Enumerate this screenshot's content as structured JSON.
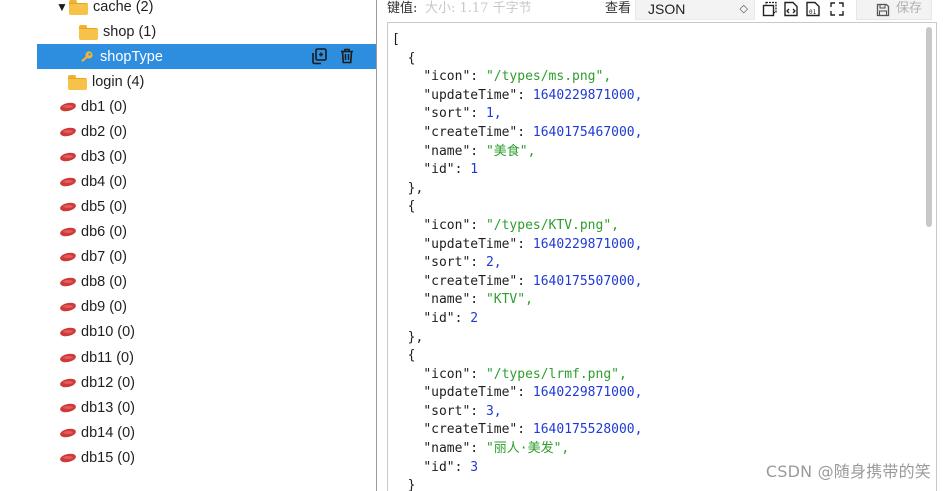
{
  "tree": {
    "cache": {
      "label": "cache (2)",
      "arrow": "▼"
    },
    "shop": {
      "label": "shop (1)"
    },
    "shopType": {
      "label": "shopType"
    },
    "login": {
      "label": "login (4)"
    },
    "dbs": [
      {
        "name": "db1",
        "count": "(0)"
      },
      {
        "name": "db2",
        "count": "(0)"
      },
      {
        "name": "db3",
        "count": "(0)"
      },
      {
        "name": "db4",
        "count": "(0)"
      },
      {
        "name": "db5",
        "count": "(0)"
      },
      {
        "name": "db6",
        "count": "(0)"
      },
      {
        "name": "db7",
        "count": "(0)"
      },
      {
        "name": "db8",
        "count": "(0)"
      },
      {
        "name": "db9",
        "count": "(0)"
      },
      {
        "name": "db10",
        "count": "(0)"
      },
      {
        "name": "db11",
        "count": "(0)"
      },
      {
        "name": "db12",
        "count": "(0)"
      },
      {
        "name": "db13",
        "count": "(0)"
      },
      {
        "name": "db14",
        "count": "(0)"
      },
      {
        "name": "db15",
        "count": "(0)"
      }
    ]
  },
  "toolbar": {
    "key_label": "键值:",
    "size_info": "大小: 1.17 千字节",
    "view_label": "查看",
    "format": "JSON",
    "save_label": "保存"
  },
  "items": [
    {
      "icon": "/types/ms.png",
      "updateTime": "1640229871000",
      "sort": "1",
      "createTime": "1640175467000",
      "name": "美食",
      "id": "1"
    },
    {
      "icon": "/types/KTV.png",
      "updateTime": "1640229871000",
      "sort": "2",
      "createTime": "1640175507000",
      "name": "KTV",
      "id": "2"
    },
    {
      "icon": "/types/lrmf.png",
      "updateTime": "1640229871000",
      "sort": "3",
      "createTime": "1640175528000",
      "name": "丽人·美发",
      "id": "3"
    }
  ],
  "watermark": "CSDN @随身携带的笑",
  "colors": {
    "selected_row": "#2d8ee0",
    "string": "#2e9e2e",
    "number": "#1f3ad6",
    "db_icon": "#cc3a3a",
    "folder": "#f7c24a"
  }
}
